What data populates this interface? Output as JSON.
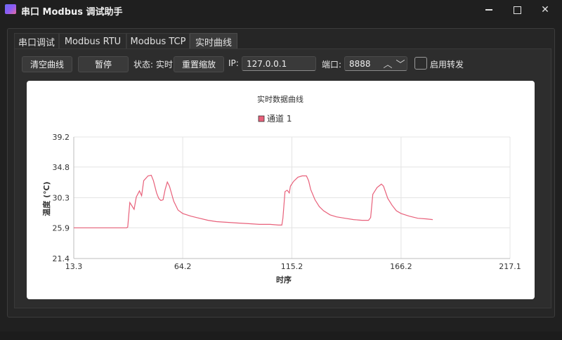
{
  "window": {
    "title": "串口 Modbus 调试助手"
  },
  "tabs": [
    {
      "label": "串口调试"
    },
    {
      "label": "Modbus RTU"
    },
    {
      "label": "Modbus TCP"
    },
    {
      "label": "实时曲线",
      "active": true
    }
  ],
  "toolbar": {
    "clear_label": "清空曲线",
    "pause_label": "暂停",
    "status_label": "状态: 实时",
    "reset_zoom_label": "重置缩放",
    "ip_label": "IP:",
    "ip_value": "127.0.0.1",
    "port_label": "端口:",
    "port_value": "8888",
    "forward_label": "启用转发",
    "forward_checked": false
  },
  "colors": {
    "accent": "#e8607a",
    "background": "#202020"
  },
  "chart_data": {
    "type": "line",
    "title": "实时数据曲线",
    "xlabel": "时序",
    "ylabel": "温度 (℃)",
    "xlim": [
      13.3,
      217.1
    ],
    "ylim": [
      21.4,
      39.2
    ],
    "x_ticks": [
      "13.3",
      "64.2",
      "115.2",
      "166.2",
      "217.1"
    ],
    "y_ticks": [
      "39.2",
      "34.8",
      "30.3",
      "25.9",
      "21.4"
    ],
    "grid": true,
    "legend_position": "top-center",
    "series": [
      {
        "name": "通道 1",
        "color": "#e8607a",
        "points": [
          [
            13.3,
            25.9
          ],
          [
            20,
            25.9
          ],
          [
            30,
            25.9
          ],
          [
            38,
            25.9
          ],
          [
            38.5,
            26.0
          ],
          [
            39.5,
            29.6
          ],
          [
            41.5,
            28.6
          ],
          [
            42.5,
            30.4
          ],
          [
            44,
            31.3
          ],
          [
            45,
            30.6
          ],
          [
            46,
            32.8
          ],
          [
            48,
            33.5
          ],
          [
            49.5,
            33.6
          ],
          [
            50.5,
            32.8
          ],
          [
            52,
            31.0
          ],
          [
            53,
            30.2
          ],
          [
            54,
            29.9
          ],
          [
            55,
            30.0
          ],
          [
            56,
            31.5
          ],
          [
            57,
            32.6
          ],
          [
            58,
            32.0
          ],
          [
            60,
            29.8
          ],
          [
            62,
            28.5
          ],
          [
            64.2,
            28.0
          ],
          [
            68,
            27.6
          ],
          [
            72,
            27.3
          ],
          [
            76,
            27.0
          ],
          [
            80,
            26.8
          ],
          [
            85,
            26.7
          ],
          [
            90,
            26.6
          ],
          [
            95,
            26.5
          ],
          [
            100,
            26.4
          ],
          [
            105,
            26.4
          ],
          [
            109,
            26.3
          ],
          [
            110.5,
            26.3
          ],
          [
            111,
            27.3
          ],
          [
            112,
            31.2
          ],
          [
            113,
            31.4
          ],
          [
            114,
            31.0
          ],
          [
            114.5,
            32.0
          ],
          [
            116,
            32.7
          ],
          [
            118,
            33.3
          ],
          [
            120,
            33.5
          ],
          [
            122,
            33.5
          ],
          [
            123,
            32.8
          ],
          [
            124,
            31.5
          ],
          [
            126,
            30.0
          ],
          [
            128,
            29.0
          ],
          [
            130,
            28.4
          ],
          [
            133,
            27.8
          ],
          [
            136,
            27.5
          ],
          [
            140,
            27.3
          ],
          [
            144,
            27.1
          ],
          [
            148,
            27.0
          ],
          [
            151,
            27.0
          ],
          [
            152,
            27.4
          ],
          [
            153,
            30.8
          ],
          [
            155,
            31.8
          ],
          [
            157,
            32.3
          ],
          [
            158,
            32.0
          ],
          [
            160,
            30.2
          ],
          [
            162,
            29.2
          ],
          [
            164,
            28.4
          ],
          [
            166.2,
            28.0
          ],
          [
            170,
            27.6
          ],
          [
            174,
            27.3
          ],
          [
            178,
            27.2
          ],
          [
            181,
            27.1
          ]
        ]
      }
    ]
  }
}
